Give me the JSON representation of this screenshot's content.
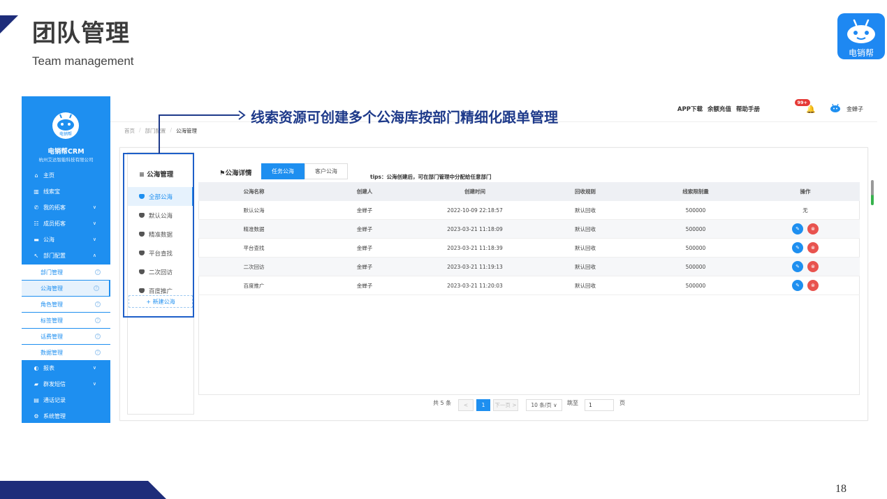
{
  "slide": {
    "title": "团队管理",
    "subtitle": "Team management",
    "page_number": "18",
    "logo_text": "电销帮",
    "annotation": "线索资源可创建多个公海库按部门精细化跟单管理"
  },
  "sidebar": {
    "logo_text": "电销帮",
    "brand": "电销帮CRM",
    "company": "杭州艾达智能科技有限公司",
    "items": [
      {
        "icon": "⌂",
        "label": "主页"
      },
      {
        "icon": "▥",
        "label": "线索宝"
      },
      {
        "icon": "✆",
        "label": "我的拓客"
      },
      {
        "icon": "☷",
        "label": "成员拓客"
      },
      {
        "icon": "▬",
        "label": "公海"
      },
      {
        "icon": "↖",
        "label": "部门配置"
      }
    ],
    "sub_items": [
      {
        "label": "部门管理"
      },
      {
        "label": "公海管理"
      },
      {
        "label": "角色管理"
      },
      {
        "label": "标签管理"
      },
      {
        "label": "话费管理"
      },
      {
        "label": "数据管理"
      }
    ],
    "bottom_items": [
      {
        "icon": "◐",
        "label": "报表"
      },
      {
        "icon": "▰",
        "label": "群发短信"
      },
      {
        "icon": "▤",
        "label": "通话记录"
      },
      {
        "icon": "⚙",
        "label": "系统管理"
      }
    ]
  },
  "topbar": {
    "links": [
      "APP下载",
      "余额充值",
      "帮助手册"
    ],
    "badge": "99+",
    "username": "金蝉子"
  },
  "breadcrumb": [
    "首页",
    "部门配置",
    "公海管理"
  ],
  "pool_list": {
    "header": "公海管理",
    "items": [
      "全部公海",
      "默认公海",
      "精准数据",
      "平台查找",
      "二次回访",
      "百度推广"
    ],
    "new_button": "+ 新建公海"
  },
  "detail": {
    "title": "公海详情",
    "tabs": [
      "任务公海",
      "客户公海"
    ],
    "tips": "tips：公海创建后，可在部门管理中分配给任意部门",
    "columns": [
      "公海名称",
      "创建人",
      "创建时间",
      "回收规则",
      "线索限制量",
      "操作"
    ],
    "rows": [
      {
        "name": "默认公海",
        "creator": "金蝉子",
        "time": "2022-10-09 22:18:57",
        "rule": "默认回收",
        "limit": "500000",
        "op": "无"
      },
      {
        "name": "精准数据",
        "creator": "金蝉子",
        "time": "2023-03-21 11:18:09",
        "rule": "默认回收",
        "limit": "500000",
        "op": ""
      },
      {
        "name": "平台查找",
        "creator": "金蝉子",
        "time": "2023-03-21 11:18:39",
        "rule": "默认回收",
        "limit": "500000",
        "op": ""
      },
      {
        "name": "二次回访",
        "creator": "金蝉子",
        "time": "2023-03-21 11:19:13",
        "rule": "默认回收",
        "limit": "500000",
        "op": ""
      },
      {
        "name": "百度推广",
        "creator": "金蝉子",
        "time": "2023-03-21 11:20:03",
        "rule": "默认回收",
        "limit": "500000",
        "op": ""
      }
    ],
    "op_icons": {
      "edit": "✎",
      "delete": "⊗"
    }
  },
  "pagination": {
    "total": "共 5 条",
    "prev": "<",
    "current": "1",
    "next": "下一页 >",
    "page_size": "10 条/页 ∨",
    "jump_label": "跳至",
    "jump_value": "1",
    "page_suffix": "页"
  },
  "colors": {
    "accent": "#1e8ff0",
    "navy": "#1e2d7a",
    "annotation": "#1e3a8a",
    "danger": "#e8534f"
  }
}
